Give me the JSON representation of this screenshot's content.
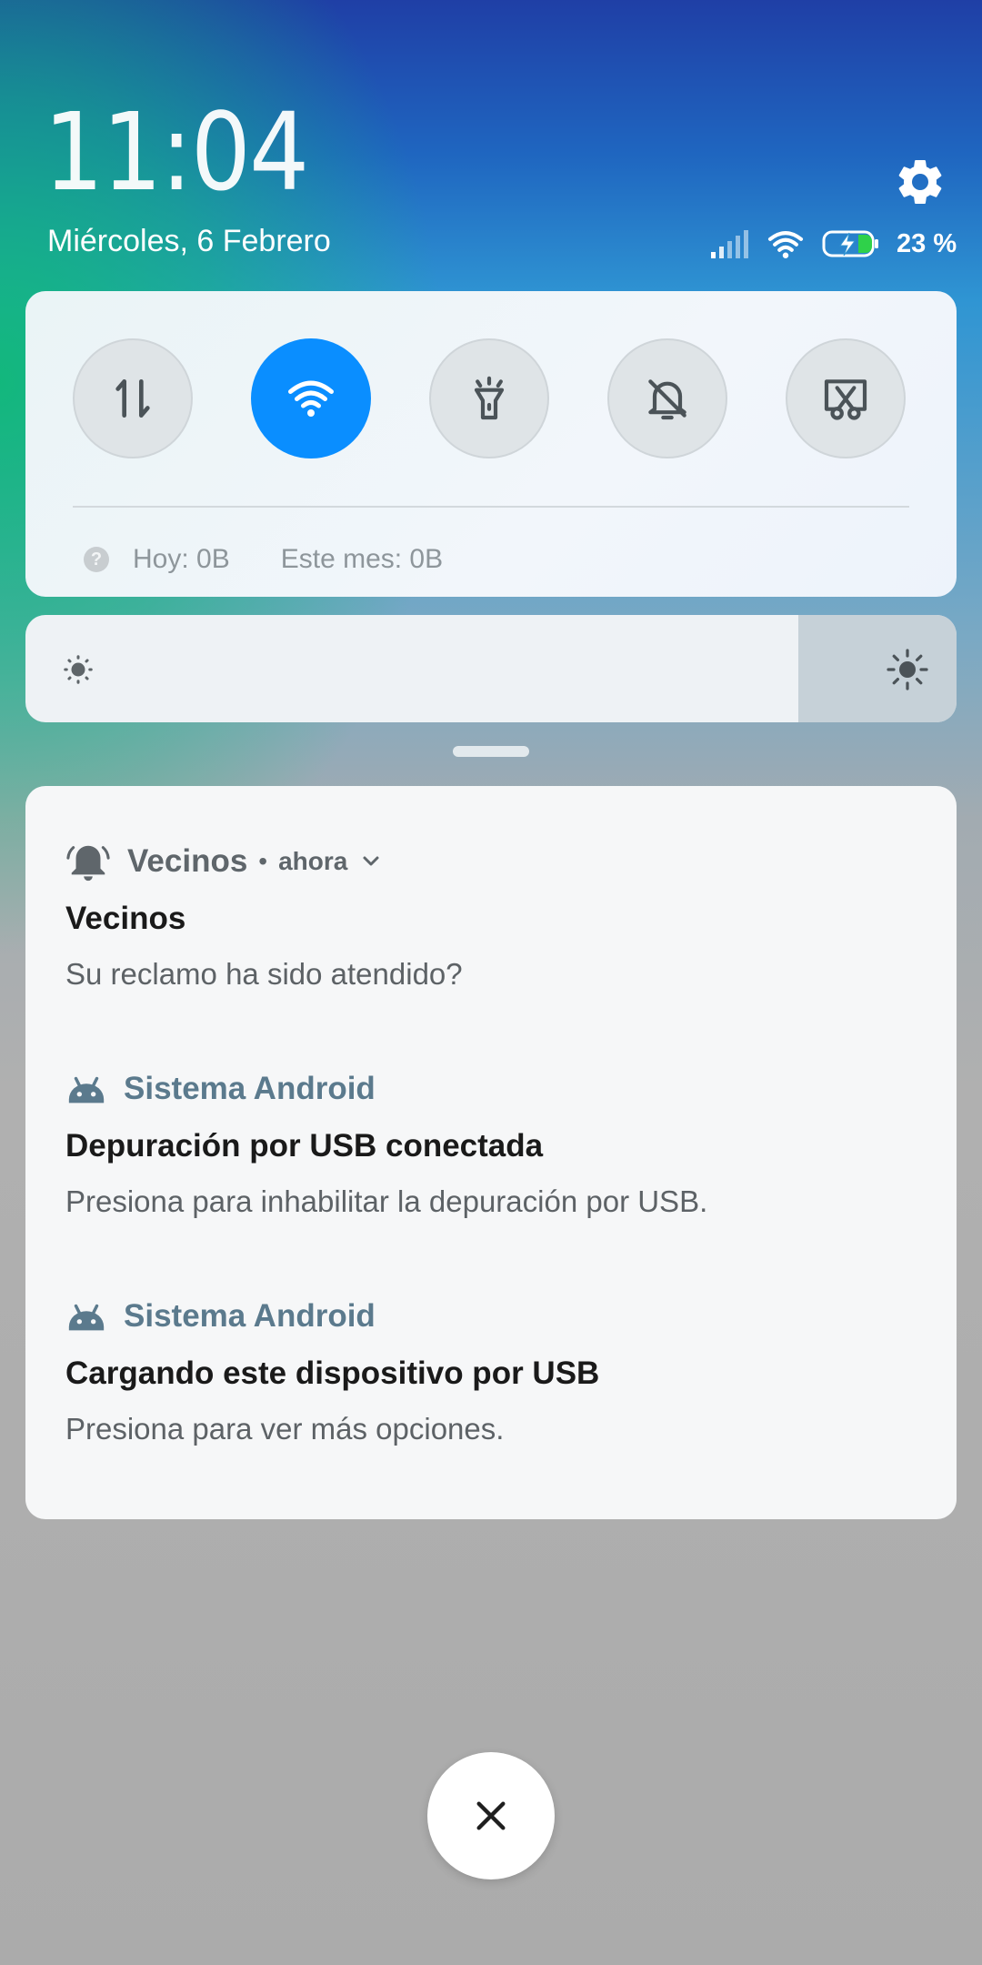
{
  "header": {
    "time": "11:04",
    "date": "Miércoles, 6 Febrero",
    "battery_percent": "23 %"
  },
  "quick_settings": {
    "toggles": [
      {
        "icon": "mobile-data-icon",
        "active": false
      },
      {
        "icon": "wifi-icon",
        "active": true
      },
      {
        "icon": "flashlight-icon",
        "active": false
      },
      {
        "icon": "bell-off-icon",
        "active": false
      },
      {
        "icon": "screenshot-icon",
        "active": false
      }
    ],
    "data_usage": {
      "today": "Hoy: 0B",
      "month": "Este mes: 0B"
    }
  },
  "brightness": {
    "level": 0.83
  },
  "notifications": [
    {
      "app": "Vecinos",
      "time": "ahora",
      "title": "Vecinos",
      "text": "Su reclamo ha sido atendido?",
      "icon": "bell-icon"
    },
    {
      "app": "Sistema Android",
      "title": "Depuración por USB conectada",
      "text": "Presiona para inhabilitar la depuración por USB.",
      "icon": "android-icon"
    },
    {
      "app": "Sistema Android",
      "title": "Cargando este dispositivo por USB",
      "text": "Presiona para ver más opciones.",
      "icon": "android-icon"
    }
  ],
  "colors": {
    "accent": "#0a8eff",
    "android_app": "#5b7a8d"
  }
}
